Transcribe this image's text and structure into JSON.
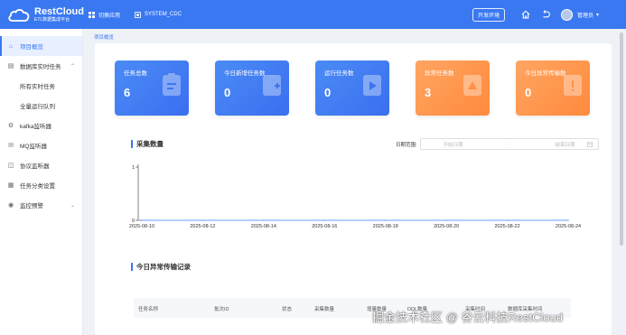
{
  "header": {
    "logo_title": "RestCloud",
    "logo_sub": "ETL数据集成平台",
    "switch_app": "切换应用",
    "system_name": "SYSTEM_CDC",
    "env_button": "开发环境",
    "user_name": "管理员"
  },
  "sidebar": {
    "items": [
      {
        "label": "项目概览",
        "icon": "home-icon",
        "active": true
      },
      {
        "label": "数据库实时任务",
        "icon": "database-icon",
        "expanded": true
      },
      {
        "label": "所有实时任务",
        "sub": true
      },
      {
        "label": "全量运行队列",
        "sub": true
      },
      {
        "label": "kafka监听器",
        "icon": "kafka-icon"
      },
      {
        "label": "MQ监听器",
        "icon": "mq-icon"
      },
      {
        "label": "协议监听器",
        "icon": "protocol-icon"
      },
      {
        "label": "任务分类设置",
        "icon": "grid-icon"
      },
      {
        "label": "监控预警",
        "icon": "alert-icon"
      }
    ]
  },
  "breadcrumb": "项目概览",
  "cards": [
    {
      "title": "任务总数",
      "value": "6",
      "color": "#3a78f2"
    },
    {
      "title": "今日新增任务数",
      "value": "0",
      "color": "#3a78f2"
    },
    {
      "title": "运行任务数",
      "value": "0",
      "color": "#3a78f2"
    },
    {
      "title": "异常任务数",
      "value": "3",
      "color": "#ff8a3d"
    },
    {
      "title": "今日异常传输数",
      "value": "0",
      "color": "#ff8a3d"
    }
  ],
  "collect_section": {
    "title": "采集数量",
    "date_label": "日期范围:",
    "start_placeholder": "开始日期",
    "separator": "-",
    "end_placeholder": "结束日期"
  },
  "chart_data": {
    "type": "line",
    "x": [
      "2025-08-10",
      "2025-08-12",
      "2025-08-14",
      "2025-08-16",
      "2025-08-18",
      "2025-08-20",
      "2025-08-22",
      "2025-08-24"
    ],
    "series": [
      {
        "values": [
          0,
          0,
          0,
          0,
          0,
          0,
          0,
          0
        ]
      }
    ],
    "ylim": [
      0,
      1
    ],
    "yticks": [
      "1",
      "0"
    ],
    "title": "采集数量",
    "xlabel": "",
    "ylabel": ""
  },
  "exception_section": {
    "title": "今日异常传输记录",
    "columns": [
      "任务名称",
      "批次ID",
      "状态",
      "采集数量",
      "增量数量",
      "DDL数量",
      "采集时间",
      "数据库采集时间"
    ]
  },
  "watermark": "掘金技术社区 @ 谷云科技RestCloud"
}
